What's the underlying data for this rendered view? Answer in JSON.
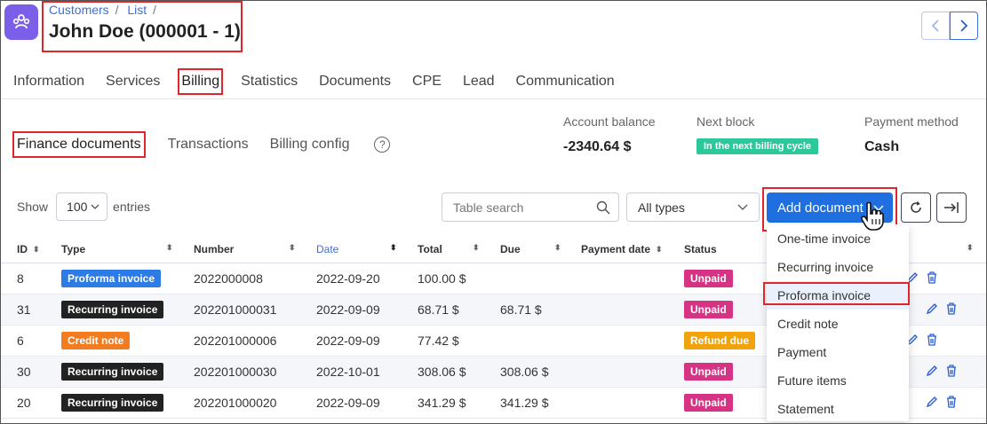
{
  "header": {
    "breadcrumb": [
      "Customers",
      "List"
    ],
    "breadcrumb_sep": "/",
    "title": "John Doe (000001 - 1)"
  },
  "tabs": [
    "Information",
    "Services",
    "Billing",
    "Statistics",
    "Documents",
    "CPE",
    "Lead",
    "Communication"
  ],
  "active_tab": "Billing",
  "subtabs": [
    "Finance documents",
    "Transactions",
    "Billing config"
  ],
  "help_glyph": "?",
  "summary": {
    "balance_label": "Account balance",
    "balance_value": "-2340.64 $",
    "next_block_label": "Next block",
    "next_block_value": "In the next billing cycle",
    "payment_method_label": "Payment method",
    "payment_method_value": "Cash"
  },
  "controls": {
    "show_label": "Show",
    "entries_value": "100",
    "entries_label": "entries",
    "search_placeholder": "Table search",
    "types_value": "All types",
    "add_document_label": "Add document"
  },
  "table": {
    "columns": [
      "ID",
      "Type",
      "Number",
      "Date",
      "Total",
      "Due",
      "Payment date",
      "Status"
    ],
    "rows": [
      {
        "id": "8",
        "type": "Proforma invoice",
        "type_color": "#2d7be5",
        "number": "2022000008",
        "date": "2022-09-20",
        "total": "100.00 $",
        "due": "",
        "status": "Unpaid",
        "status_color": "#d63384"
      },
      {
        "id": "31",
        "type": "Recurring invoice",
        "type_color": "#222222",
        "number": "202201000031",
        "date": "2022-09-09",
        "total": "68.71 $",
        "due": "68.71 $",
        "status": "Unpaid",
        "status_color": "#d63384"
      },
      {
        "id": "6",
        "type": "Credit note",
        "type_color": "#f47c20",
        "number": "202201000006",
        "date": "2022-09-09",
        "total": "77.42 $",
        "due": "",
        "status": "Refund due",
        "status_color": "#f0a30a"
      },
      {
        "id": "30",
        "type": "Recurring invoice",
        "type_color": "#222222",
        "number": "202201000030",
        "date": "2022-10-01",
        "total": "308.06 $",
        "due": "308.06 $",
        "status": "Unpaid",
        "status_color": "#d63384"
      },
      {
        "id": "20",
        "type": "Recurring invoice",
        "type_color": "#222222",
        "number": "202201000020",
        "date": "2022-09-09",
        "total": "341.29 $",
        "due": "341.29 $",
        "status": "Unpaid",
        "status_color": "#d63384"
      }
    ]
  },
  "dropdown": {
    "items": [
      "One-time invoice",
      "Recurring invoice",
      "Proforma invoice",
      "Credit note",
      "Payment",
      "Future items",
      "Statement"
    ],
    "highlighted": "Proforma invoice"
  },
  "colors": {
    "accent": "#1f6fe0",
    "brand": "#7b5fe8",
    "highlight_border": "#e0262d",
    "badge_green": "#2cc79a"
  }
}
